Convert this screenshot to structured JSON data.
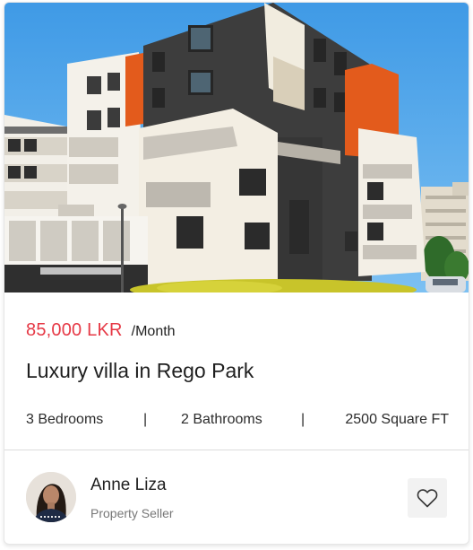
{
  "listing": {
    "image_alt": "Modern apartment building",
    "price": "85,000 LKR",
    "period": "/Month",
    "title": "Luxury villa in Rego Park",
    "features": {
      "bedrooms": "3 Bedrooms",
      "bathrooms": "2 Bathrooms",
      "area": "2500 Square FT",
      "separator": "|"
    }
  },
  "seller": {
    "name": "Anne Liza",
    "role": "Property Seller",
    "avatar_icon": "avatar-photo"
  },
  "actions": {
    "favorite_icon": "heart-outline-icon"
  },
  "colors": {
    "price": "#e63946",
    "sky": "#4aa3e8",
    "building_dark": "#3d3d3d",
    "building_light": "#f2efe8",
    "accent_orange": "#e35b1c",
    "fav_bg": "#f2f2f2"
  }
}
